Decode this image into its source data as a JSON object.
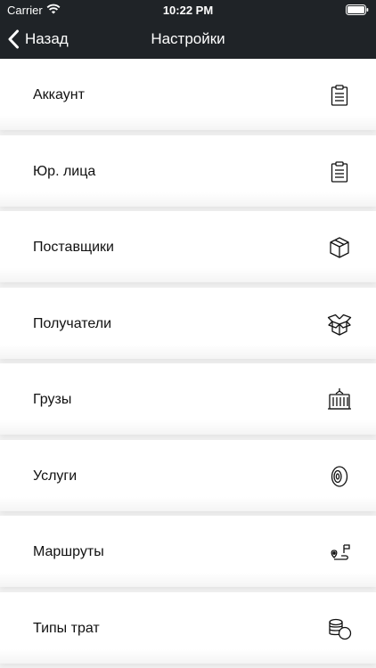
{
  "status_bar": {
    "carrier": "Carrier",
    "time": "10:22 PM"
  },
  "nav": {
    "back_label": "Назад",
    "title": "Настройки"
  },
  "colors": {
    "header_bg": "#1f2327",
    "header_text": "#ffffff",
    "row_bg": "#ffffff",
    "row_text": "#111111"
  },
  "items": [
    {
      "label": "Аккаунт",
      "icon": "clipboard-icon"
    },
    {
      "label": "Юр. лица",
      "icon": "clipboard-icon"
    },
    {
      "label": "Поставщики",
      "icon": "box-icon"
    },
    {
      "label": "Получатели",
      "icon": "open-box-icon"
    },
    {
      "label": "Грузы",
      "icon": "container-icon"
    },
    {
      "label": "Услуги",
      "icon": "tire-icon"
    },
    {
      "label": "Маршруты",
      "icon": "route-icon"
    },
    {
      "label": "Типы трат",
      "icon": "coins-icon"
    }
  ]
}
